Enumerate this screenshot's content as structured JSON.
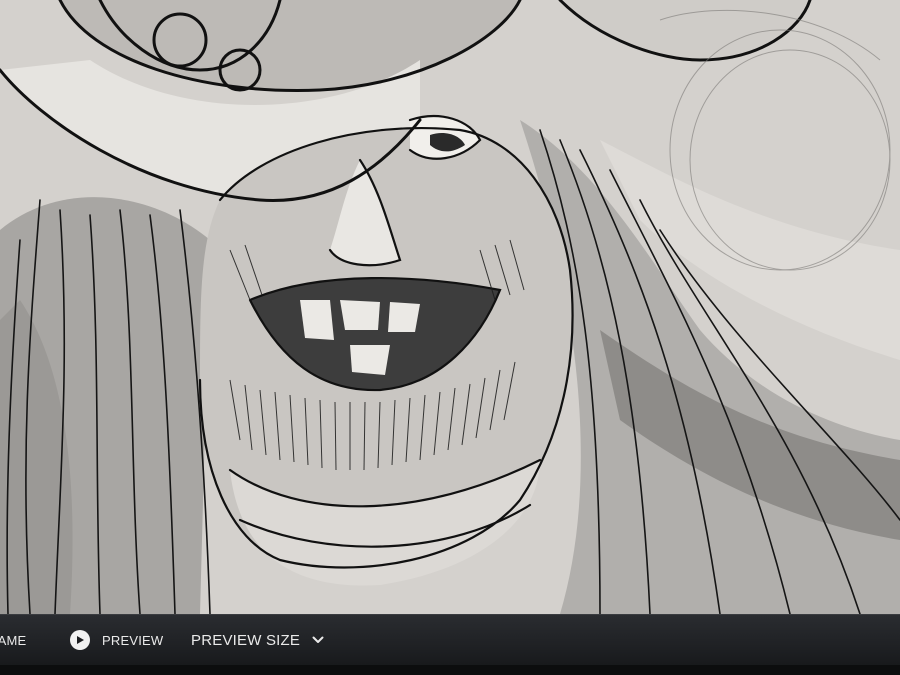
{
  "canvas": {
    "subject": "sketch-canvas",
    "palette": {
      "paper": "#d6d3cf",
      "shade": "#8f8d8b",
      "light": "#e4e2de",
      "ink": "#161616"
    }
  },
  "toolbar": {
    "frame_label": "RAME",
    "preview_label": "PREVIEW",
    "preview_size_label": "PREVIEW SIZE",
    "preview_icon": "play-icon",
    "size_icon": "chevron-down-icon",
    "background": "#1d1f22",
    "text_color": "#eaeaea"
  }
}
